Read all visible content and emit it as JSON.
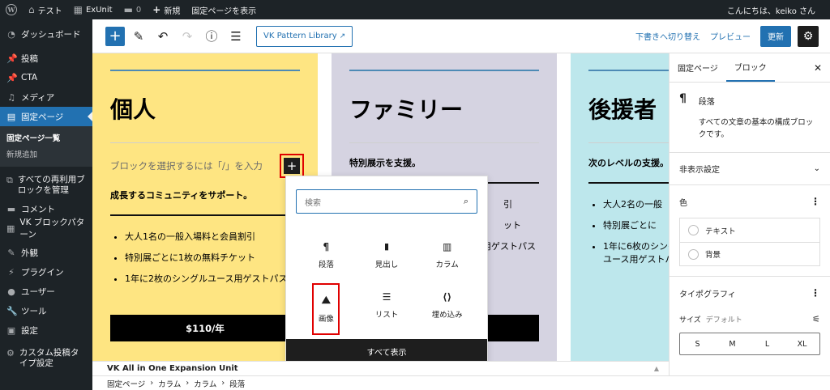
{
  "admin_bar": {
    "site_name": "テスト",
    "plugin": "ExUnit",
    "comments_count": "0",
    "new_label": "新規",
    "view_page": "固定ページを表示",
    "greeting": "こんにちは、keiko さん"
  },
  "sidebar": {
    "items": [
      {
        "label": "ダッシュボード",
        "icon": "dashboard-icon"
      },
      {
        "label": "投稿",
        "icon": "pin-icon"
      },
      {
        "label": "CTA",
        "icon": "pin-icon"
      },
      {
        "label": "メディア",
        "icon": "media-icon"
      },
      {
        "label": "固定ページ",
        "icon": "page-icon"
      },
      {
        "label": "すべての再利用ブロックを管理",
        "icon": "reusable-icon"
      },
      {
        "label": "コメント",
        "icon": "comment-icon"
      },
      {
        "label": "VK ブロックパターン",
        "icon": "grid-icon"
      },
      {
        "label": "外観",
        "icon": "brush-icon"
      },
      {
        "label": "プラグイン",
        "icon": "plugin-icon"
      },
      {
        "label": "ユーザー",
        "icon": "user-icon"
      },
      {
        "label": "ツール",
        "icon": "wrench-icon"
      },
      {
        "label": "設定",
        "icon": "settings-icon"
      },
      {
        "label": "カスタム投稿タイプ設定",
        "icon": "gear-icon"
      }
    ],
    "submenu": [
      "固定ページ一覧",
      "新規追加"
    ]
  },
  "toolbar": {
    "vk_pattern": "VK Pattern Library",
    "switch_draft": "下書きへ切り替え",
    "preview": "プレビュー",
    "update": "更新"
  },
  "columns": [
    {
      "title": "個人",
      "placeholder": "ブロックを選択するには「/」を入力",
      "lead": "成長するコミュニティをサポート。",
      "items": [
        "大人1名の一般入場料と会員割引",
        "特別展ごとに1枚の無料チケット",
        "1年に2枚のシングルユース用ゲストパス"
      ],
      "price": "$110/年"
    },
    {
      "title": "ファミリー",
      "lead": "特別展示を支援。",
      "items": [
        "大人2名の一般入場料と会員割引",
        "特別展ごとにチケット",
        "1年に4枚のシングルユース用ゲストパス"
      ],
      "price": ""
    },
    {
      "title": "後援者",
      "lead": "次のレベルの支援。",
      "items": [
        "大人2名の一般",
        "特別展ごとに",
        "1年に6枚のシングルユース用ゲストパス"
      ],
      "price": ""
    }
  ],
  "inserter": {
    "search_placeholder": "検索",
    "blocks": [
      {
        "label": "段落",
        "icon": "¶"
      },
      {
        "label": "見出し",
        "icon": "🔖"
      },
      {
        "label": "カラム",
        "icon": "▥"
      },
      {
        "label": "画像",
        "icon": "🖼"
      },
      {
        "label": "リスト",
        "icon": "☰"
      },
      {
        "label": "埋め込み",
        "icon": "⟨⟩"
      }
    ],
    "browse_all": "すべて表示"
  },
  "meta_box": "VK All in One Expansion Unit",
  "breadcrumb": [
    "固定ページ",
    "カラム",
    "カラム",
    "段落"
  ],
  "settings_panel": {
    "tabs": [
      "固定ページ",
      "ブロック"
    ],
    "block_name": "段落",
    "block_desc": "すべての文章の基本の構成ブロックです。",
    "hidden_settings": "非表示設定",
    "color": "色",
    "color_text": "テキスト",
    "color_bg": "背景",
    "typography": "タイポグラフィ",
    "size_label": "サイズ",
    "size_default": "デフォルト",
    "sizes": [
      "S",
      "M",
      "L",
      "XL"
    ]
  }
}
